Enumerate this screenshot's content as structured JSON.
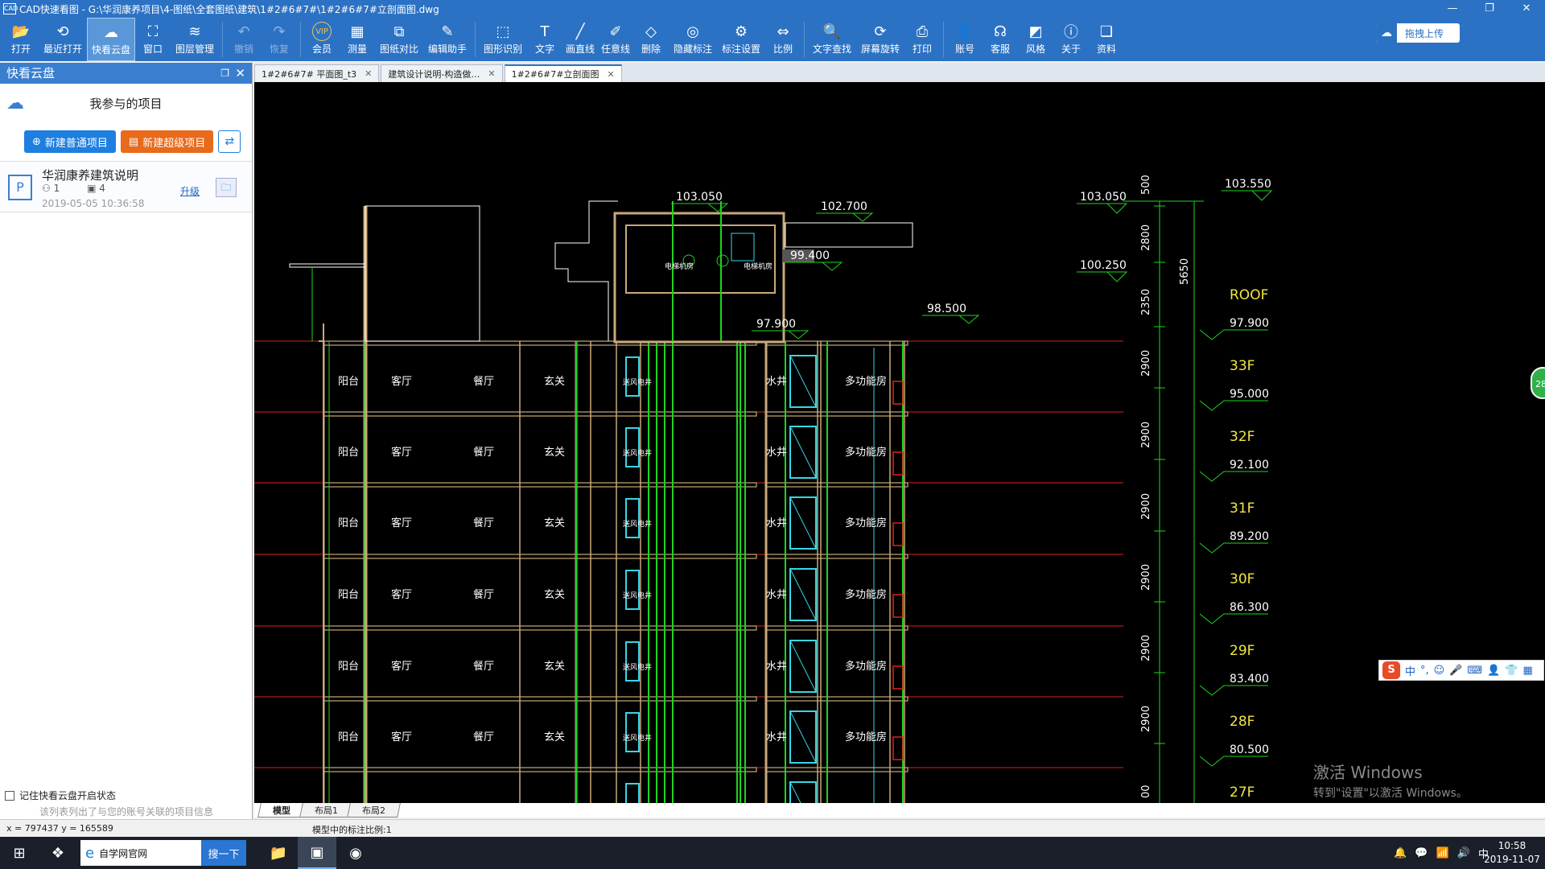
{
  "window": {
    "app_icon": "CAD",
    "title": "CAD快速看图 - G:\\华润康养项目\\4-图纸\\全套图纸\\建筑\\1#2#6#7#\\1#2#6#7#立剖面图.dwg",
    "minimize": "—",
    "maximize": "❐",
    "close": "✕"
  },
  "toolbar": {
    "items": [
      {
        "label": "打开",
        "icon": "folder-open-icon",
        "glyph": "📂"
      },
      {
        "label": "最近打开",
        "icon": "history-icon",
        "glyph": "⟲"
      },
      {
        "label": "快看云盘",
        "icon": "cloud-icon",
        "glyph": "☁"
      },
      {
        "label": "窗口",
        "icon": "window-icon",
        "glyph": "⛶"
      },
      {
        "label": "图层管理",
        "icon": "layers-icon",
        "glyph": "≋"
      },
      {
        "label": "撤销",
        "icon": "undo-icon",
        "glyph": "↶"
      },
      {
        "label": "恢复",
        "icon": "redo-icon",
        "glyph": "↷"
      },
      {
        "label": "会员",
        "icon": "vip-icon",
        "glyph": "VIP"
      },
      {
        "label": "测量",
        "icon": "measure-icon",
        "glyph": "▦"
      },
      {
        "label": "图纸对比",
        "icon": "compare-icon",
        "glyph": "⧉"
      },
      {
        "label": "编辑助手",
        "icon": "edit-assistant-icon",
        "glyph": "✎"
      },
      {
        "label": "图形识别",
        "icon": "shape-recognition-icon",
        "glyph": "⬚"
      },
      {
        "label": "文字",
        "icon": "text-icon",
        "glyph": "T"
      },
      {
        "label": "画直线",
        "icon": "line-icon",
        "glyph": "╱"
      },
      {
        "label": "任意线",
        "icon": "freehand-icon",
        "glyph": "✐"
      },
      {
        "label": "删除",
        "icon": "eraser-icon",
        "glyph": "◇"
      },
      {
        "label": "隐藏标注",
        "icon": "hide-annotation-icon",
        "glyph": "◎"
      },
      {
        "label": "标注设置",
        "icon": "annotation-settings-icon",
        "glyph": "⚙"
      },
      {
        "label": "比例",
        "icon": "scale-icon",
        "glyph": "⇔"
      },
      {
        "label": "文字查找",
        "icon": "text-search-icon",
        "glyph": "🔍"
      },
      {
        "label": "屏幕旋转",
        "icon": "rotate-screen-icon",
        "glyph": "⟳"
      },
      {
        "label": "打印",
        "icon": "print-icon",
        "glyph": "⎙"
      },
      {
        "label": "账号",
        "icon": "account-icon",
        "glyph": "👤"
      },
      {
        "label": "客服",
        "icon": "headset-icon",
        "glyph": "☊"
      },
      {
        "label": "风格",
        "icon": "style-icon",
        "glyph": "◩"
      },
      {
        "label": "关于",
        "icon": "info-icon",
        "glyph": "ⓘ"
      },
      {
        "label": "资料",
        "icon": "docs-icon",
        "glyph": "❏"
      }
    ],
    "upload_label": "拖拽上传",
    "upload_icon": "cloud-upload-icon"
  },
  "sidebar": {
    "title": "快看云盘",
    "heading": "我参与的项目",
    "new_normal": "新建普通项目",
    "new_super": "新建超级项目",
    "project": {
      "name": "华润康养建筑说明",
      "members": "1",
      "files": "4",
      "date": "2019-05-05 10:36:58",
      "upgrade": "升级"
    },
    "remember": "记住快看云盘开启状态",
    "hint": "该列表列出了与您的账号关联的项目信息"
  },
  "tabs": [
    {
      "label": "1#2#6#7# 平面图_t3",
      "active": false
    },
    {
      "label": "建筑设计说明-构造做…",
      "active": false
    },
    {
      "label": "1#2#6#7#立剖面图",
      "active": true
    }
  ],
  "drawing": {
    "room_labels": [
      "阳台",
      "客厅",
      "餐厅",
      "玄关",
      "送风电井",
      "水井",
      "多功能房"
    ],
    "elevations_top": [
      "103.050",
      "102.700",
      "99.400",
      "97.900",
      "98.500"
    ],
    "machine_rooms": [
      "电梯机房",
      "电梯机房"
    ],
    "right_levels": [
      {
        "floor": "ROOF",
        "elev": "97.900"
      },
      {
        "floor": "33F",
        "elev": "95.000"
      },
      {
        "floor": "32F",
        "elev": "92.100"
      },
      {
        "floor": "31F",
        "elev": "89.200"
      },
      {
        "floor": "30F",
        "elev": "86.300"
      },
      {
        "floor": "29F",
        "elev": "83.400"
      },
      {
        "floor": "28F",
        "elev": "80.500"
      },
      {
        "floor": "27F",
        "elev": ""
      }
    ],
    "right_top_elevs": [
      "103.050",
      "100.250",
      "103.550"
    ],
    "dims": [
      "500",
      "2800",
      "2350",
      "2900",
      "2900",
      "2900",
      "2900",
      "2900",
      "2900",
      "00"
    ],
    "dim_total": "5650"
  },
  "layout_tabs": [
    "模型",
    "布局1",
    "布局2"
  ],
  "status": {
    "coords": "x = 797437  y = 165589",
    "scale": "模型中的标注比例:1"
  },
  "taskbar": {
    "search_text": "自学网官网",
    "search_button": "搜一下",
    "time": "10:58",
    "date": "2019-11-07",
    "ime_lang": "中"
  },
  "watermark": {
    "line1": "激活 Windows",
    "line2": "转到\"设置\"以激活 Windows。"
  },
  "badge": "28",
  "colors": {
    "title_bar": "#2b72c4",
    "cad_background": "#000000",
    "floor_line": "#e0201a",
    "wall": "#c9a97a",
    "yellow_text": "#f2e640",
    "green_line": "#1ed41e",
    "cyan": "#38d6e6"
  }
}
